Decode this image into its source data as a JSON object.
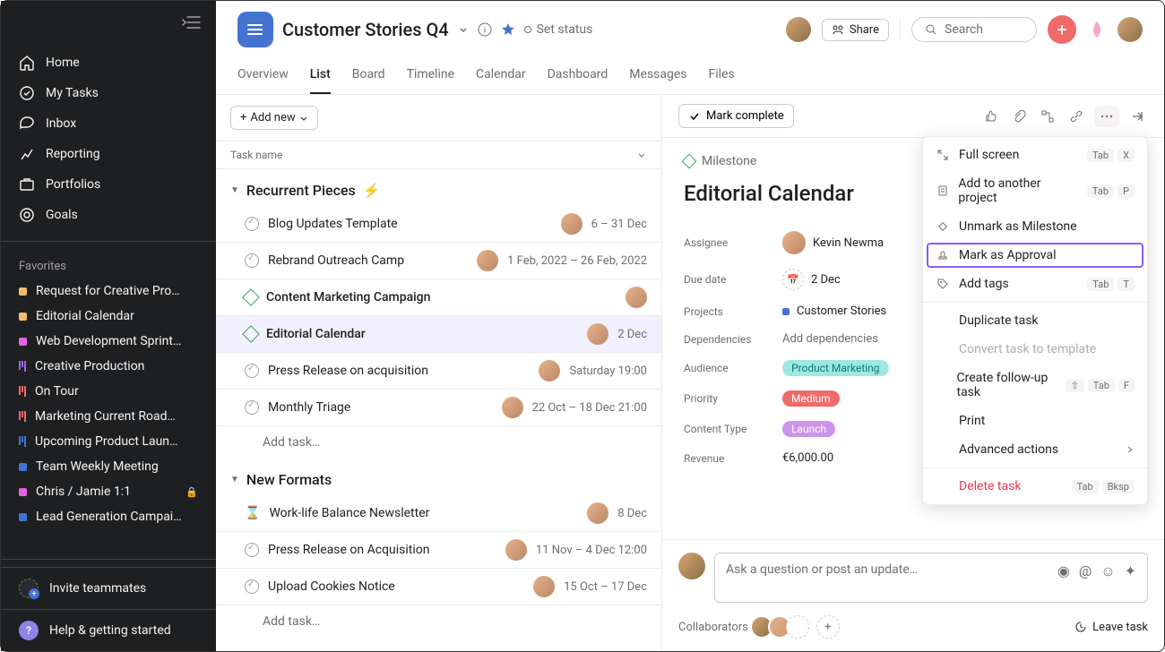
{
  "sidebar": {
    "nav": [
      {
        "label": "Home"
      },
      {
        "label": "My Tasks"
      },
      {
        "label": "Inbox"
      },
      {
        "label": "Reporting"
      },
      {
        "label": "Portfolios"
      },
      {
        "label": "Goals"
      }
    ],
    "favorites_header": "Favorites",
    "favorites": [
      {
        "label": "Request for Creative Pro…",
        "color": "#f1bd6c",
        "type": "dot"
      },
      {
        "label": "Editorial Calendar",
        "color": "#f1bd6c",
        "type": "dot"
      },
      {
        "label": "Web Development Sprint…",
        "color": "#e362e3",
        "type": "dot"
      },
      {
        "label": "Creative Production",
        "type": "bars",
        "bars": "purple"
      },
      {
        "label": "On Tour",
        "type": "bars",
        "bars": "red"
      },
      {
        "label": "Marketing Current Road…",
        "type": "bars",
        "bars": "red"
      },
      {
        "label": "Upcoming Product Laun…",
        "type": "bars",
        "bars": "blue"
      },
      {
        "label": "Team Weekly Meeting",
        "color": "#4573d2",
        "type": "dot"
      },
      {
        "label": "Chris / Jamie 1:1",
        "color": "#e362e3",
        "type": "dot",
        "locked": true
      },
      {
        "label": "Lead Generation Campai…",
        "color": "#4573d2",
        "type": "dot"
      }
    ],
    "invite": "Invite teammates",
    "help": "Help & getting started",
    "help_badge": "?"
  },
  "header": {
    "title": "Customer Stories Q4",
    "status": "Set status",
    "share": "Share",
    "search_placeholder": "Search",
    "tabs": [
      "Overview",
      "List",
      "Board",
      "Timeline",
      "Calendar",
      "Dashboard",
      "Messages",
      "Files"
    ],
    "active_tab": 1
  },
  "list": {
    "add_new": "Add new",
    "col_header": "Task name",
    "sections": [
      {
        "name": "Recurrent Pieces",
        "lightning": true,
        "tasks": [
          {
            "type": "task",
            "name": "Blog Updates Template",
            "date": "6 – 31 Dec",
            "avatar": true
          },
          {
            "type": "task",
            "name": "Rebrand Outreach Camp",
            "date": "1 Feb, 2022 – 26 Feb, 2022",
            "avatar": true
          },
          {
            "type": "milestone",
            "name": "Content Marketing Campaign",
            "date": "",
            "avatar": true
          },
          {
            "type": "milestone",
            "name": "Editorial Calendar",
            "date": "2 Dec",
            "avatar": true,
            "selected": true
          },
          {
            "type": "task",
            "name": "Press Release on acquisition",
            "date": "Saturday 19:00",
            "avatar": true
          },
          {
            "type": "task",
            "name": "Monthly Triage",
            "date": "22 Oct – 18 Dec 21:00",
            "avatar": true
          }
        ],
        "add_task": "Add task…"
      },
      {
        "name": "New Formats",
        "lightning": false,
        "tasks": [
          {
            "type": "hourglass",
            "name": "Work-life Balance Newsletter",
            "date": "8 Dec",
            "avatar": true
          },
          {
            "type": "task",
            "name": "Press Release on Acquisition",
            "date": "11 Nov – 4 Dec 12:00",
            "avatar": true
          },
          {
            "type": "task",
            "name": "Upload Cookies Notice",
            "date": "15 Oct – 17 Dec",
            "avatar": true
          }
        ],
        "add_task": "Add task…"
      }
    ]
  },
  "detail": {
    "mark_complete": "Mark complete",
    "milestone_label": "Milestone",
    "title": "Editorial Calendar",
    "fields": {
      "assignee_label": "Assignee",
      "assignee_value": "Kevin Newma",
      "due_label": "Due date",
      "due_value": "2 Dec",
      "projects_label": "Projects",
      "projects_value": "Customer Stories",
      "deps_label": "Dependencies",
      "deps_value": "Add dependencies",
      "audience_label": "Audience",
      "audience_value": "Product Marketing",
      "priority_label": "Priority",
      "priority_value": "Medium",
      "content_label": "Content Type",
      "content_value": "Launch",
      "revenue_label": "Revenue",
      "revenue_value": "€6,000.00"
    },
    "comment_placeholder": "Ask a question or post an update…",
    "collaborators_label": "Collaborators",
    "leave_task": "Leave task"
  },
  "dropdown": {
    "items": [
      {
        "label": "Full screen",
        "icon": "expand",
        "kbd": [
          "Tab",
          "X"
        ]
      },
      {
        "label": "Add to another project",
        "icon": "clipboard",
        "kbd": [
          "Tab",
          "P"
        ]
      },
      {
        "label": "Unmark as Milestone",
        "icon": "diamond"
      },
      {
        "label": "Mark as Approval",
        "icon": "stamp",
        "highlighted": true
      },
      {
        "label": "Add tags",
        "icon": "tag",
        "kbd": [
          "Tab",
          "T"
        ]
      },
      {
        "sep": true
      },
      {
        "label": "Duplicate task"
      },
      {
        "label": "Convert task to template",
        "disabled": true
      },
      {
        "label": "Create follow-up task",
        "kbd": [
          "⇧",
          "Tab",
          "F"
        ]
      },
      {
        "label": "Print"
      },
      {
        "label": "Advanced actions",
        "chevron": true
      },
      {
        "sep": true
      },
      {
        "label": "Delete task",
        "danger": true,
        "kbd": [
          "Tab",
          "Bksp"
        ]
      }
    ]
  }
}
